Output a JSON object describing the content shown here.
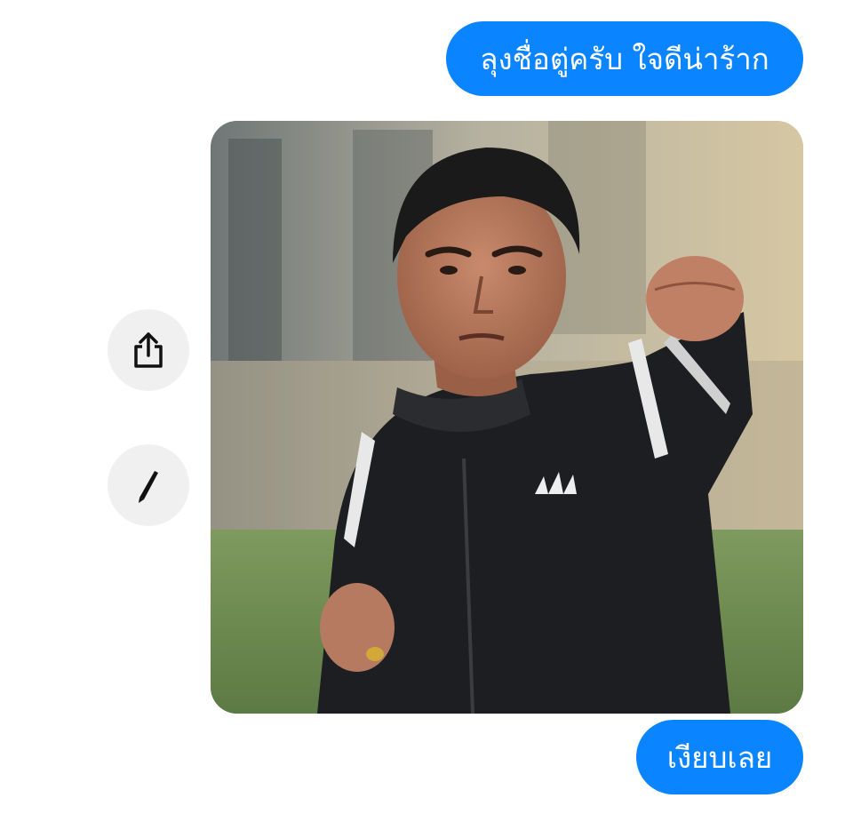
{
  "conversation": {
    "messages": [
      {
        "sender": "self",
        "type": "text",
        "text": "ลุงชื่อตู่ครับ ใจดีน่าร้าก"
      },
      {
        "sender": "self",
        "type": "image",
        "image_icon": "photo-man-punching"
      },
      {
        "sender": "self",
        "type": "text",
        "text": "เงียบเลย"
      }
    ]
  },
  "actions": {
    "share_icon": "share-icon",
    "edit_icon": "pencil-icon"
  },
  "colors": {
    "bubble": "#0a84ff",
    "bubble_text": "#ffffff",
    "action_bg": "#f0f0f0",
    "icon": "#111111"
  }
}
